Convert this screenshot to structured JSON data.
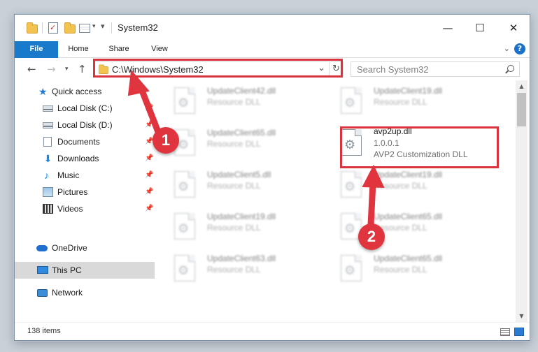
{
  "window": {
    "title": "System32"
  },
  "ribbon": {
    "tabs": [
      "File",
      "Home",
      "Share",
      "View"
    ],
    "help": "?"
  },
  "address": {
    "path": "C:\\Windows\\System32",
    "search_placeholder": "Search System32"
  },
  "navigation": {
    "items": [
      {
        "label": "Quick access",
        "icon": "star-icon",
        "pinned": false
      },
      {
        "label": "Local Disk (C:)",
        "icon": "disk-icon",
        "pinned": true
      },
      {
        "label": "Local Disk (D:)",
        "icon": "disk-icon",
        "pinned": true
      },
      {
        "label": "Documents",
        "icon": "documents-icon",
        "pinned": true
      },
      {
        "label": "Downloads",
        "icon": "download-icon",
        "pinned": true
      },
      {
        "label": "Music",
        "icon": "music-icon",
        "pinned": true
      },
      {
        "label": "Pictures",
        "icon": "pictures-icon",
        "pinned": true
      },
      {
        "label": "Videos",
        "icon": "videos-icon",
        "pinned": true
      },
      {
        "label": "OneDrive",
        "icon": "cloud-icon",
        "pinned": false
      },
      {
        "label": "This PC",
        "icon": "computer-icon",
        "pinned": false,
        "selected": true
      },
      {
        "label": "Network",
        "icon": "network-icon",
        "pinned": false
      }
    ]
  },
  "files": {
    "left": [
      {
        "name": "UpdateClient42.dll",
        "type": "Resource DLL"
      },
      {
        "name": "UpdateClient65.dll",
        "type": "Resource DLL"
      },
      {
        "name": "UpdateClient5.dll",
        "type": "Resource DLL"
      },
      {
        "name": "UpdateClient19.dll",
        "type": "Resource DLL"
      },
      {
        "name": "UpdateClient63.dll",
        "type": "Resource DLL"
      }
    ],
    "right": [
      {
        "name": "UpdateClient19.dll",
        "type": "Resource DLL"
      },
      {
        "name": "UpdateClient19.dll",
        "type": "Resource DLL"
      },
      {
        "name": "UpdateClient65.dll",
        "type": "Resource DLL"
      },
      {
        "name": "UpdateClient65.dll",
        "type": "Resource DLL"
      }
    ],
    "highlighted": {
      "name": "avp2up.dll",
      "version": "1.0.0.1",
      "description": "AVP2 Customization DLL"
    }
  },
  "status": {
    "item_count": "138 items"
  },
  "annotations": {
    "step1": "1",
    "step2": "2",
    "color": "#e0353f"
  }
}
